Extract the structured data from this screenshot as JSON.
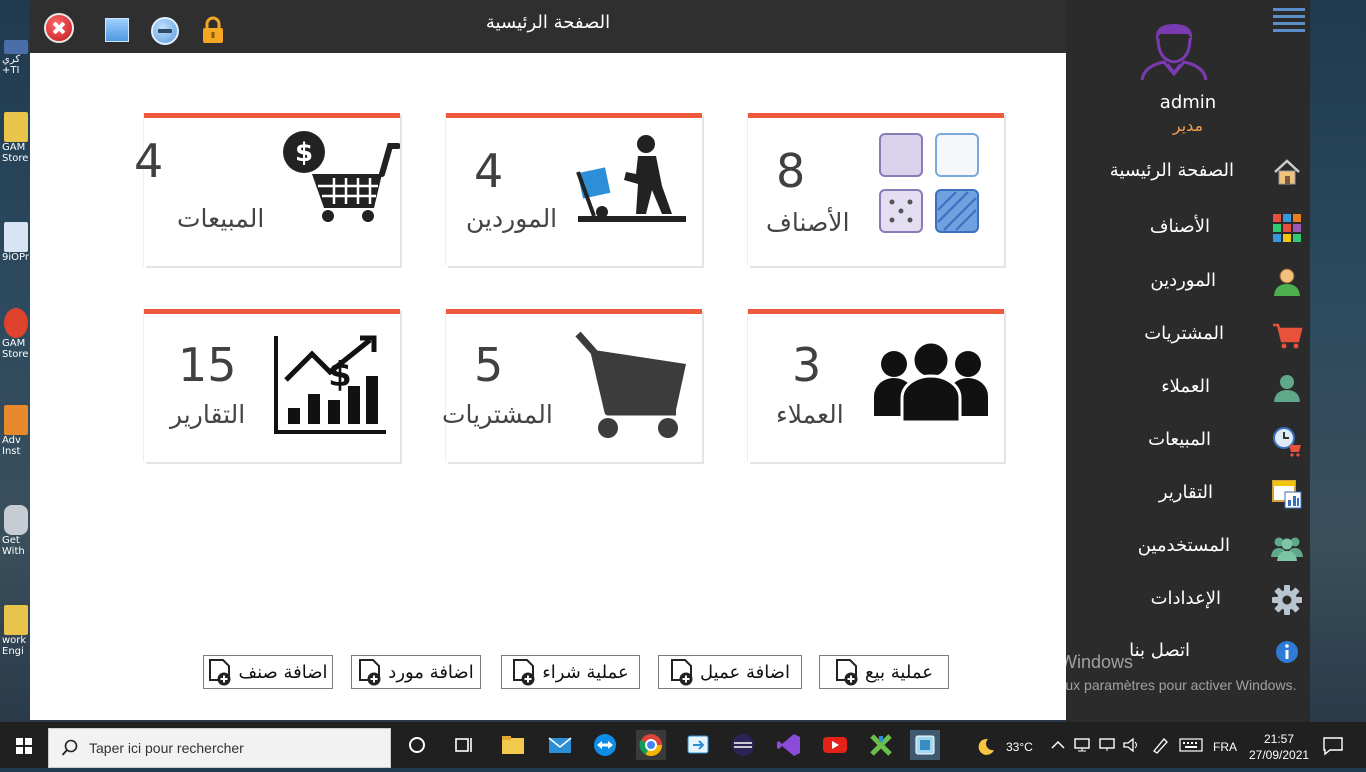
{
  "window": {
    "title": "الصفحة الرئيسية"
  },
  "desktop_icons": [
    "كري +TI",
    "GAM Store",
    "9iOPr",
    "GAM Store",
    "Adv Inst",
    "Get With",
    "work Engi"
  ],
  "cards": [
    {
      "id": "sales",
      "value": "4",
      "label": "المبيعات"
    },
    {
      "id": "suppliers",
      "value": "4",
      "label": "الموردين"
    },
    {
      "id": "categories",
      "value": "8",
      "label": "الأصناف"
    },
    {
      "id": "reports",
      "value": "15",
      "label": "التقارير"
    },
    {
      "id": "purchases",
      "value": "5",
      "label": "المشتريات"
    },
    {
      "id": "customers",
      "value": "3",
      "label": "العملاء"
    }
  ],
  "quick_actions": [
    "اضافة صنف",
    "اضافة مورد",
    "عملية شراء",
    "اضافة عميل",
    "عملية بيع"
  ],
  "user": {
    "name": "admin",
    "role": "مدير"
  },
  "nav": [
    "الصفحة الرئيسية",
    "الأصناف",
    "الموردين",
    "المشتريات",
    "العملاء",
    "المبيعات",
    "التقارير",
    "المستخدمين",
    "الإعدادات",
    "اتصل بنا"
  ],
  "watermark": {
    "line1": "Activer Windows",
    "line2": "Accédez aux paramètres pour activer Windows."
  },
  "taskbar": {
    "search_placeholder": "Taper ici pour rechercher",
    "temp": "33°C",
    "lang": "FRA",
    "time": "21:57",
    "date": "27/09/2021"
  },
  "colors": {
    "accent": "#f05a3c",
    "sidebar": "#2b2b2b",
    "titlebar": "#2f2f2f",
    "role": "#f0a050"
  }
}
